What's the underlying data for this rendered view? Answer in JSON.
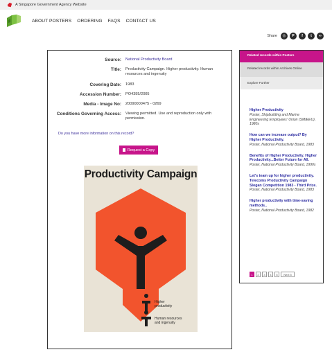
{
  "gov_banner": {
    "text": "A Singapore Government Agency Website"
  },
  "nav": {
    "items": [
      "ABOUT POSTERS",
      "ORDERING",
      "FAQS",
      "CONTACT US"
    ]
  },
  "share": {
    "label": "Share",
    "icons": [
      "instagram-icon",
      "pinterest-icon",
      "facebook-icon",
      "twitter-icon",
      "link-icon"
    ]
  },
  "record": {
    "fields": [
      {
        "key": "Source:",
        "value": "National Productivity Board",
        "link": true
      },
      {
        "key": "Title:",
        "value": "Productivity Campaign. Higher productivity. Human resources and ingenuity",
        "link": false
      },
      {
        "key": "Covering Date:",
        "value": "1983",
        "link": false
      },
      {
        "key": "Accession Number:",
        "value": "PO4395/2005",
        "link": false
      },
      {
        "key": "Media - Image No:",
        "value": "20090000475 - 0269",
        "link": false
      },
      {
        "key": "Conditions Governing Access:",
        "value": "Viewing permitted. Use and reproduction only with permission.",
        "link": false
      }
    ],
    "more_info": "Do you have more information on this record?",
    "request_button": "Request a Copy"
  },
  "poster": {
    "title": "Productivity Campaign",
    "caption1": "Higher productivity",
    "caption2": "Human resources and ingenuity",
    "colors": {
      "background": "#e9e3d6",
      "orange": "#f2542d",
      "black": "#1d1d1d"
    }
  },
  "side": {
    "tabs": [
      "Related records within Posters",
      "Related records within Archives Online",
      "Explore Further"
    ],
    "items": [
      {
        "title": "Higher Productivity",
        "detail": "Poster, Shipbuilding and Marine Engineering Employees' Union (SMIEEU), 1980s"
      },
      {
        "title": "How can we increase output? By Higher Productivity.",
        "detail": "Poster, National Productivity Board, 1983"
      },
      {
        "title": "Benefits of Higher Productivity. Higher Productivity...Better Future for All.",
        "detail": "Poster, National Productivity Board, 1990s"
      },
      {
        "title": "Let's team up for higher productivity. Telecoms Productivity Campaign Slogan Competition 1983 - Third Prize.",
        "detail": "Poster, National Productivity Board, 1983"
      },
      {
        "title": "Higher productivity with time-saving methods..",
        "detail": "Poster, National Productivity Board, 1982"
      }
    ],
    "pager": {
      "pages": [
        "1",
        "2",
        "3",
        "4",
        "5"
      ],
      "next": "Next 5",
      "current": "1"
    }
  },
  "accent_color": "#c7158a"
}
